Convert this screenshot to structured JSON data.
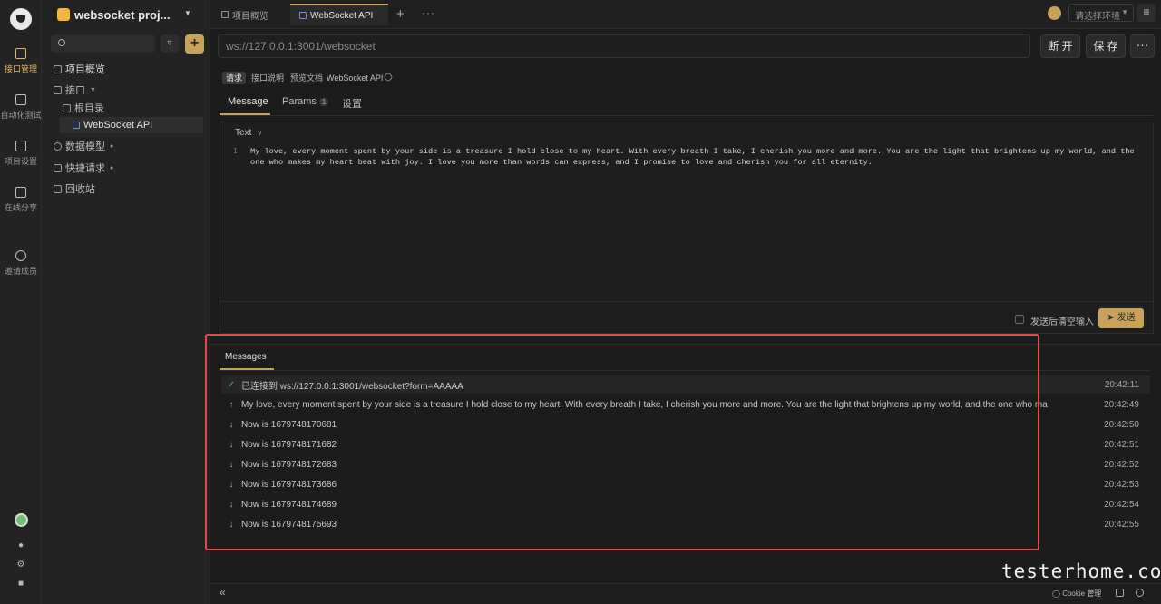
{
  "rail": {
    "items": [
      {
        "label": "接口管理",
        "icon": "api-management-icon"
      },
      {
        "label": "自动化测试",
        "icon": "automation-icon"
      },
      {
        "label": "项目设置",
        "icon": "project-settings-icon"
      },
      {
        "label": "在线分享",
        "icon": "share-icon"
      },
      {
        "label": "邀请成员",
        "icon": "invite-icon"
      }
    ]
  },
  "sidebar": {
    "project_name": "websocket proj...",
    "search_placeholder": "",
    "tree": [
      {
        "label": "项目概览"
      },
      {
        "label": "接口"
      },
      {
        "label": "根目录"
      },
      {
        "label": "WebSocket API"
      },
      {
        "label": "数据模型"
      },
      {
        "label": "快捷请求"
      },
      {
        "label": "回收站"
      }
    ]
  },
  "tabs": [
    {
      "label": "项目概览"
    },
    {
      "label": "WebSocket API"
    }
  ],
  "env": {
    "placeholder": "请选择环境"
  },
  "request": {
    "url": "ws://127.0.0.1:3001/websocket",
    "disconnect_label": "断 开",
    "save_label": "保 存"
  },
  "subtabs": {
    "chips": [
      "请求",
      "接口说明",
      "预览文档"
    ],
    "api_name": "WebSocket API"
  },
  "message_tabs": {
    "message": "Message",
    "params": "Params",
    "params_count": "1",
    "settings": "设置"
  },
  "editor": {
    "format": "Text",
    "line_number": "1",
    "content": "My love, every moment spent by your side is a treasure I hold close to my heart. With every breath I take, I cherish you more and more. You are the light that brightens up my world, and the one who makes my heart beat with joy. I love you more than words can express, and I promise to love and cherish you for all eternity.",
    "clear_after_send": "发送后清空输入",
    "send_label": "发送"
  },
  "messages": {
    "tab_label": "Messages",
    "rows": [
      {
        "type": "connected",
        "text": "已连接到 ws://127.0.0.1:3001/websocket?form=AAAAA",
        "time": "20:42:11"
      },
      {
        "type": "sent",
        "text": "My love, every moment spent by your side is a treasure I hold close to my heart. With every breath I take, I cherish you more and more. You are the light that brightens up my world, and the one who ma",
        "time": "20:42:49"
      },
      {
        "type": "received",
        "text": "Now is 1679748170681",
        "time": "20:42:50"
      },
      {
        "type": "received",
        "text": "Now is 1679748171682",
        "time": "20:42:51"
      },
      {
        "type": "received",
        "text": "Now is 1679748172683",
        "time": "20:42:52"
      },
      {
        "type": "received",
        "text": "Now is 1679748173686",
        "time": "20:42:53"
      },
      {
        "type": "received",
        "text": "Now is 1679748174689",
        "time": "20:42:54"
      },
      {
        "type": "received",
        "text": "Now is 1679748175693",
        "time": "20:42:55"
      }
    ]
  },
  "footer": {
    "cookie_label": "Cookie 管理"
  },
  "watermark": "testerhome.com",
  "colors": {
    "accent": "#c9a25a",
    "highlight_border": "#e34a4a",
    "success": "#5cb85c"
  }
}
